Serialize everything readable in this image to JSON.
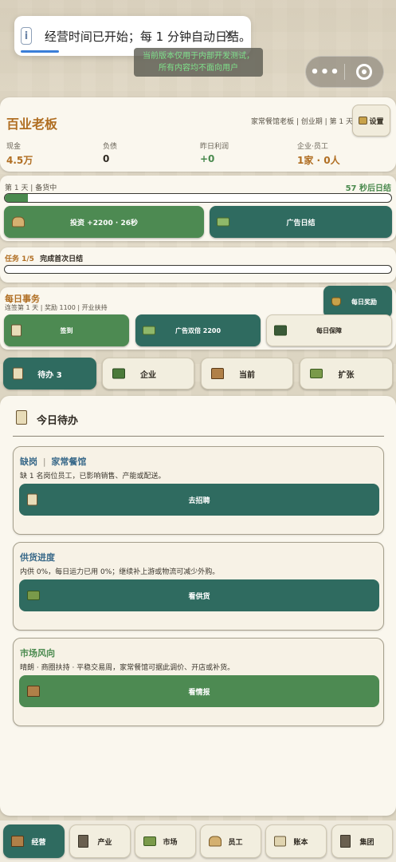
{
  "toast": {
    "icon": "info-icon",
    "text": "经营时间已开始；每 1 分钟自动日结。",
    "close": "×"
  },
  "notice": {
    "line1": "当前版本仅用于内部开发测试，",
    "line2": "所有内容均不面向用户"
  },
  "capsule": {
    "menu": "•••",
    "close": "close-circle-icon"
  },
  "header": {
    "title": "百业老板",
    "meta": "家常餐馆老板 | 创业期 | 第 1 天",
    "settings_label": "设置",
    "stats": [
      {
        "label": "现金",
        "value": "4.5万",
        "color": "#b06e22"
      },
      {
        "label": "负债",
        "value": "0",
        "color": "#2f2a22"
      },
      {
        "label": "昨日利润",
        "value": "+0",
        "color": "#4a8a4e"
      },
      {
        "label": "企业·员工",
        "value": "1家 · 0人",
        "color": "#b06e22"
      }
    ]
  },
  "day": {
    "status": "第 1 天 | 备货中",
    "countdown": "57 秒后日结",
    "progress": 0.06,
    "invest_label": "投资 +2200 · 26秒",
    "ad_settle_label": "广告日结"
  },
  "task": {
    "tag": "任务 1/5",
    "title": "完成首次日结",
    "progress": 0.0
  },
  "daily": {
    "title": "每日事务",
    "meta": "连签第 1 天 | 奖励 1100 | 开业扶持",
    "reward_label": "每日奖励",
    "checkin_label": "签到",
    "ad_double_label": "广告双倍 2200",
    "guarantee_label": "每日保障"
  },
  "tabs": [
    {
      "label": "待办 3",
      "active": true
    },
    {
      "label": "企业",
      "active": false
    },
    {
      "label": "当前",
      "active": false
    },
    {
      "label": "扩张",
      "active": false
    }
  ],
  "today": {
    "title": "今日待办",
    "cards": [
      {
        "title_a": "缺岗",
        "title_b": "家常餐馆",
        "desc": "缺 1 名岗位员工，已影响销售、产能或配送。",
        "button": "去招聘",
        "title_color": "#3a6a8a"
      },
      {
        "title_a": "供货进度",
        "title_b": "",
        "desc": "内供 0%，每日运力已用 0%；继续补上游或物流可减少外购。",
        "button": "看供货",
        "title_color": "#3a6a8a"
      },
      {
        "title_a": "市场风向",
        "title_b": "",
        "desc": "晴朗 · 商圈扶持 · 平稳交易周，家常餐馆可据此调价、开店或补货。",
        "button": "看情报",
        "title_color": "#4a8a4e"
      }
    ]
  },
  "nav": [
    {
      "label": "经营",
      "active": true
    },
    {
      "label": "产业",
      "active": false
    },
    {
      "label": "市场",
      "active": false
    },
    {
      "label": "员工",
      "active": false
    },
    {
      "label": "账本",
      "active": false
    },
    {
      "label": "集团",
      "active": false
    }
  ],
  "colors": {
    "green": "#4d8a52",
    "teal": "#2f6b60",
    "accent": "#b06e22",
    "cream": "#faf7ee"
  }
}
